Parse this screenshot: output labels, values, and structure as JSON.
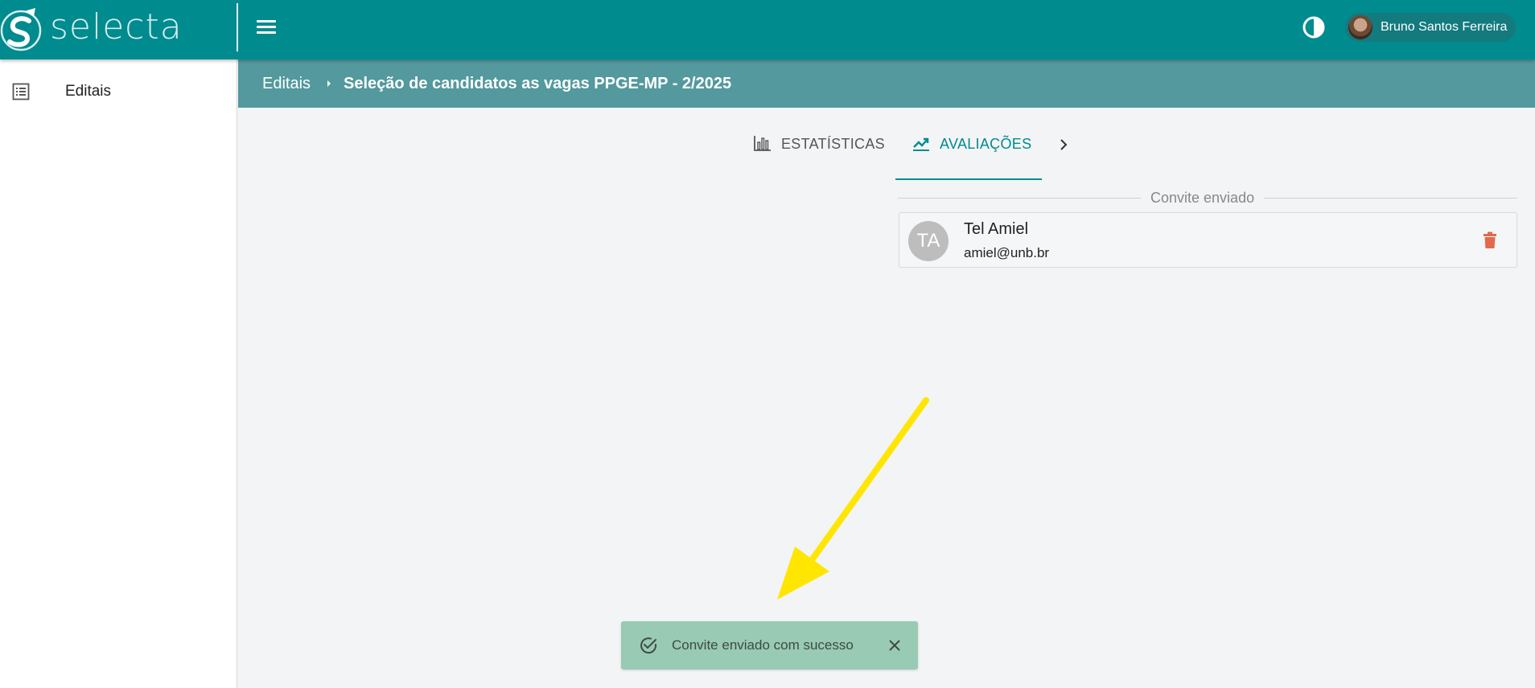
{
  "app": {
    "logo_text": "selecta",
    "user_name": "Bruno Santos Ferreira",
    "brand_color": "#008b8f"
  },
  "sidebar": {
    "items": [
      {
        "label": "Editais",
        "icon": "list-icon"
      }
    ]
  },
  "breadcrumb": {
    "parent": "Editais",
    "current": "Seleção de candidatos as vagas PPGE-MP - 2/2025"
  },
  "tabs": [
    {
      "label": "ESTATÍSTICAS",
      "icon": "bar-chart-icon",
      "active": false
    },
    {
      "label": "AVALIAÇÕES",
      "icon": "trending-up-icon",
      "active": true
    }
  ],
  "invites": {
    "section_label": "Convite enviado",
    "items": [
      {
        "initials": "TA",
        "name": "Tel Amiel",
        "email": "amiel@unb.br"
      }
    ]
  },
  "toast": {
    "message": "Convite enviado com sucesso",
    "status_color": "#98cab4"
  },
  "annotation": {
    "arrow_color": "#ffe600"
  }
}
